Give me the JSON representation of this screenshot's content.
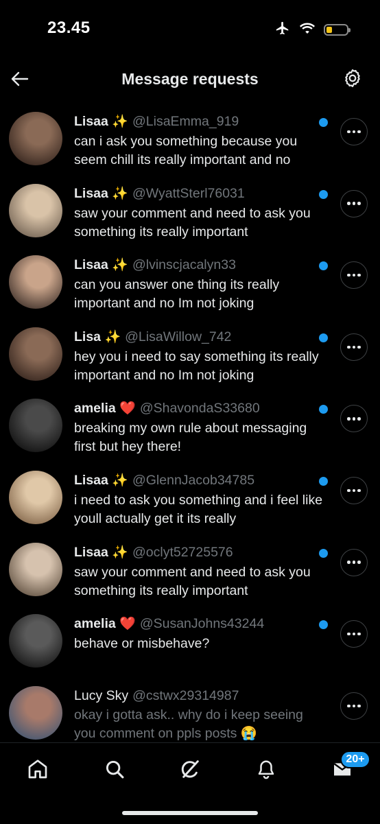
{
  "status_bar": {
    "time": "23.45",
    "battery_level": 0.3
  },
  "header": {
    "title": "Message requests"
  },
  "requests": [
    {
      "name": "Lisaa",
      "emoji": "✨",
      "handle": "@LisaEmma_919",
      "preview": "can i ask you something because you seem chill its really important and no",
      "unread": true,
      "avatar_colors": [
        "#8a6a56",
        "#3b2a22"
      ]
    },
    {
      "name": "Lisaa",
      "emoji": "✨",
      "handle": "@WyattSterl76031",
      "preview": "saw your comment and need to ask you something its really important",
      "unread": true,
      "avatar_colors": [
        "#d9c3a8",
        "#7a6a5a"
      ]
    },
    {
      "name": "Lisaa",
      "emoji": "✨",
      "handle": "@lvinscjacalyn33",
      "preview": "can you answer one thing its really important and no Im not joking",
      "unread": true,
      "avatar_colors": [
        "#c9a48a",
        "#4a3a32"
      ]
    },
    {
      "name": "Lisa",
      "emoji": "✨",
      "handle": "@LisaWillow_742",
      "preview": "hey you i need to say something its really important and no Im not joking",
      "unread": true,
      "avatar_colors": [
        "#8a6a56",
        "#3b2a22"
      ]
    },
    {
      "name": "amelia",
      "emoji": "❤️",
      "handle": "@ShavondaS33680",
      "preview": "breaking my own rule about messaging first but hey there!",
      "unread": true,
      "avatar_colors": [
        "#4a4a4a",
        "#151515"
      ]
    },
    {
      "name": "Lisaa",
      "emoji": "✨",
      "handle": "@GlennJacob34785",
      "preview": "i need to ask you something and i feel like youll actually get it its really",
      "unread": true,
      "avatar_colors": [
        "#e0c8a8",
        "#8a6e52"
      ]
    },
    {
      "name": "Lisaa",
      "emoji": "✨",
      "handle": "@oclyt52725576",
      "preview": "saw your comment and need to ask you something its really important",
      "unread": true,
      "avatar_colors": [
        "#d6c2ae",
        "#6a5a4a"
      ]
    },
    {
      "name": "amelia",
      "emoji": "❤️",
      "handle": "@SusanJohns43244",
      "preview": "behave or misbehave?",
      "unread": true,
      "avatar_colors": [
        "#5a5a5a",
        "#1a1a1a"
      ]
    },
    {
      "name": "Lucy Sky",
      "emoji": "",
      "handle": "@cstwx29314987",
      "preview": "okay i gotta ask.. why do i keep seeing you comment on ppls posts 😭",
      "unread": false,
      "avatar_colors": [
        "#a87a6a",
        "#4a5a72"
      ]
    }
  ],
  "tab_bar": {
    "tabs": [
      {
        "name": "home",
        "icon": "home-icon"
      },
      {
        "name": "search",
        "icon": "search-icon"
      },
      {
        "name": "grok",
        "icon": "grok-icon"
      },
      {
        "name": "notifications",
        "icon": "bell-icon"
      },
      {
        "name": "messages",
        "icon": "mail-icon"
      }
    ],
    "messages_badge": "20+"
  },
  "colors": {
    "accent": "#1d9bf0",
    "background": "#000000",
    "muted_text": "#71767b"
  }
}
